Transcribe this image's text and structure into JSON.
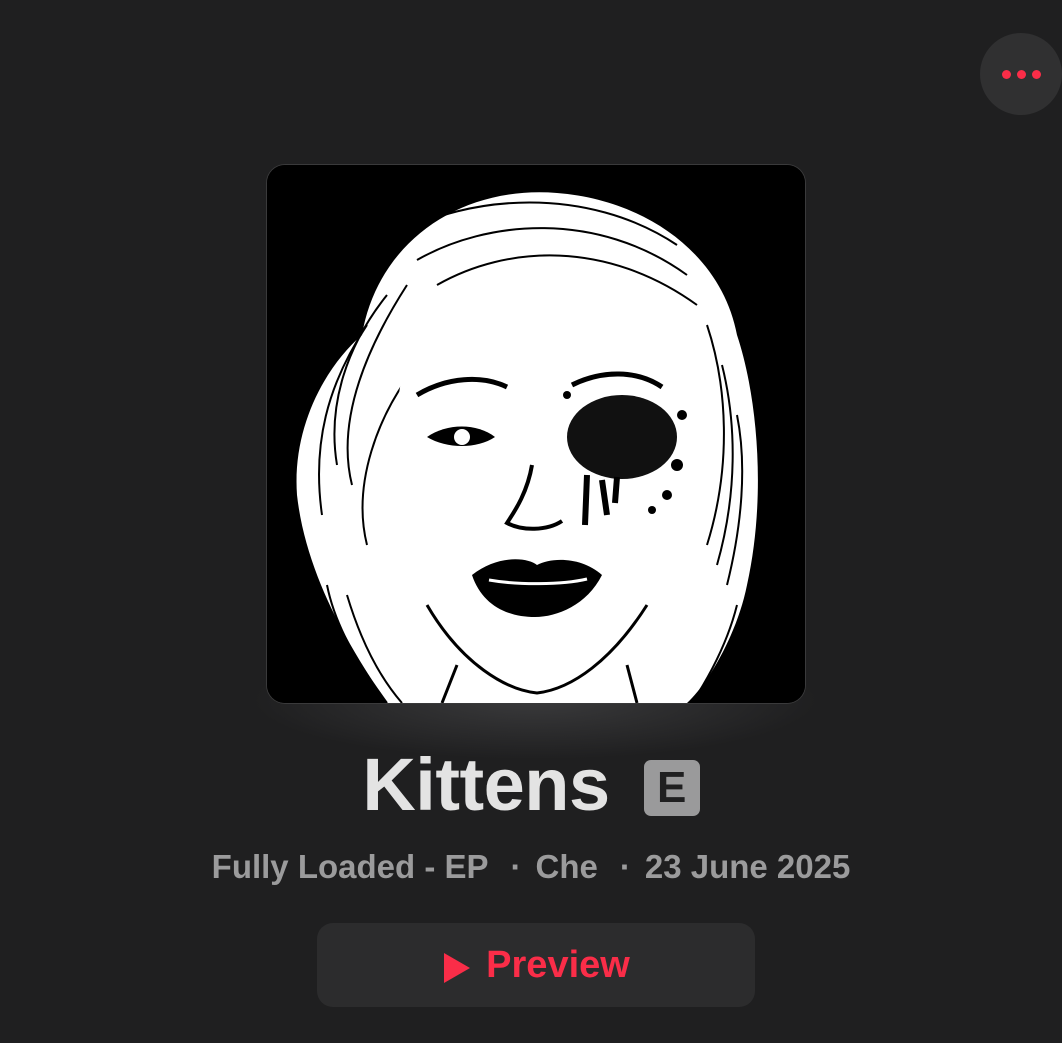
{
  "colors": {
    "background": "#1f1f20",
    "accent": "#fa2d48",
    "title": "#e3e3e3",
    "secondary": "#9b9b9c"
  },
  "header": {
    "more_icon": "ellipsis-icon"
  },
  "artwork": {
    "icon": "album-artwork-illustration"
  },
  "song": {
    "title": "Kittens",
    "explicit_badge": "E"
  },
  "meta": {
    "album": "Fully Loaded - EP",
    "separator": "·",
    "artist": "Che",
    "release_date": "23 June 2025"
  },
  "actions": {
    "preview_label": "Preview",
    "preview_icon": "play-icon"
  }
}
